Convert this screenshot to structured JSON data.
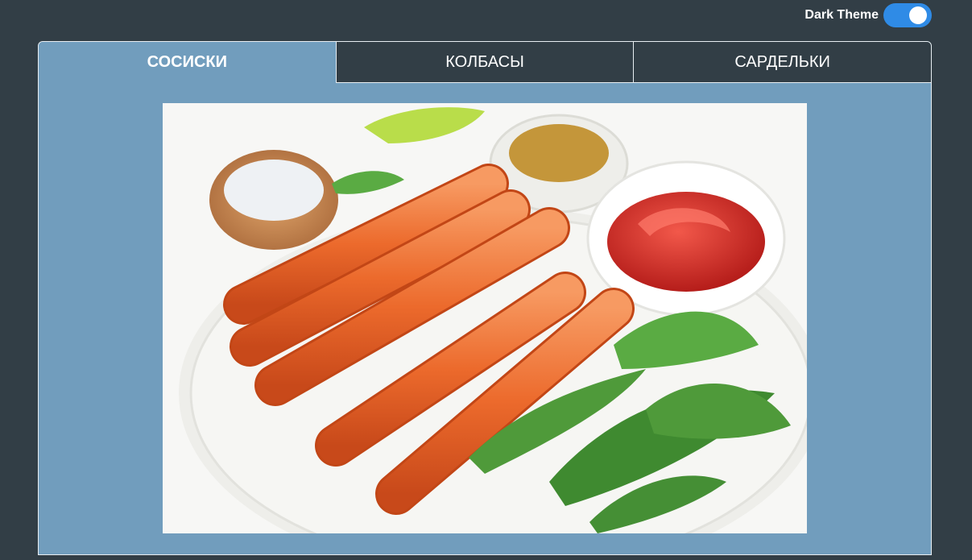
{
  "header": {
    "theme_toggle_label": "Dark Theme",
    "theme_toggle_on": true
  },
  "tabs": [
    {
      "label": "СОСИСКИ",
      "active": true
    },
    {
      "label": "КОЛБАСЫ",
      "active": false
    },
    {
      "label": "САРДЕЛЬКИ",
      "active": false
    }
  ],
  "colors": {
    "background": "#323e46",
    "panel": "#719dbd",
    "toggle_accent": "#2f8be6"
  },
  "image": {
    "subject": "grilled sausages with salt, mustard, ketchup and arugula"
  }
}
